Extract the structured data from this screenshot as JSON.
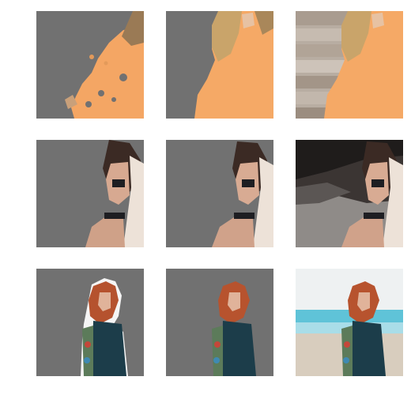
{
  "figure": {
    "layout": "3x3 grid",
    "column_roles": [
      "segmentation-mask-coarse",
      "segmentation-mask-refined",
      "original-photo"
    ],
    "colors": {
      "mask_background": "#717171",
      "page_background": "#ffffff"
    },
    "rows": [
      {
        "subject": "woman-in-orange-tank-top",
        "scene_background": "stone-steps"
      },
      {
        "subject": "woman-in-bikini-and-cardigan",
        "scene_background": "sea-cave"
      },
      {
        "subject": "red-haired-woman-with-tattooed-arm",
        "scene_background": "beach-and-sea"
      }
    ]
  }
}
